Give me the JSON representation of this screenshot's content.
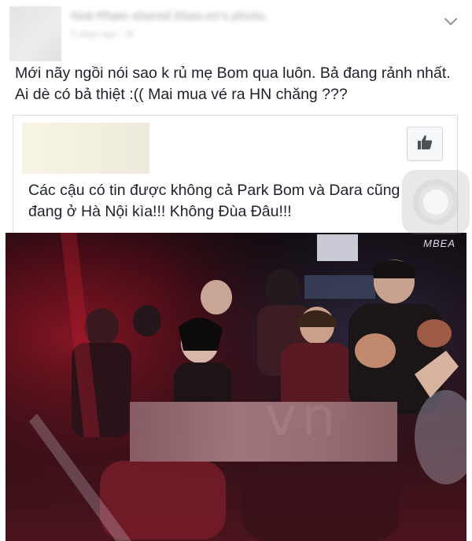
{
  "header": {
    "author_blurred": "Hoà Phạm shared 2Sao.vn's photo.",
    "meta_blurred": "5 days ago · ⚙",
    "menu_icon": "chevron-down-icon"
  },
  "post": {
    "text": "Mới nãy ngồi nói sao k rủ mẹ Bom qua luôn. Bả đang rảnh nhất. Ai dè có bả thiệt :(( Mai mua vé ra HN chăng ???"
  },
  "shared": {
    "text": "Các cậu có tin được không cả Park Bom và Dara cũng đang ở Hà Nội kìa!!! Không Đùa Đâu!!!",
    "like_icon": "thumbs-up-icon"
  },
  "photo": {
    "watermark": "vn",
    "logo": "MBEA"
  },
  "colors": {
    "text": "#1d2129",
    "border": "#dadde1",
    "muted": "#b9b8bb"
  }
}
